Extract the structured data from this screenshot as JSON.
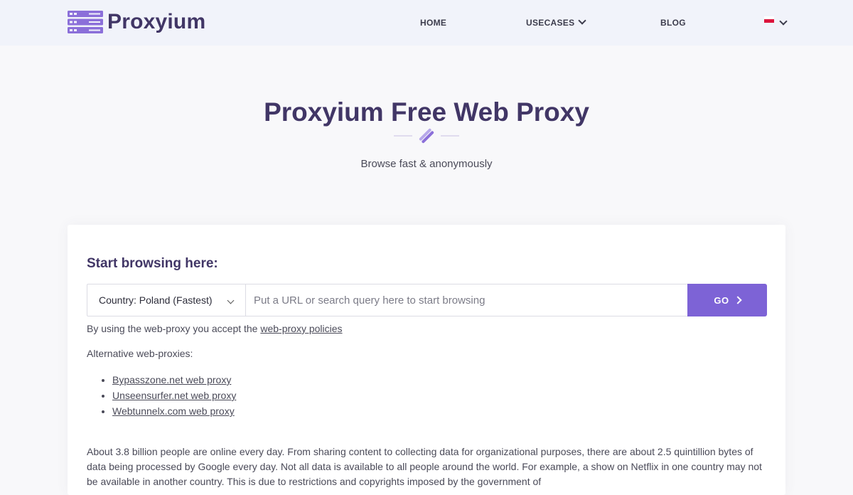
{
  "brand": {
    "name": "Proxyium"
  },
  "nav": {
    "home": "HOME",
    "usecases": "USECASES",
    "blog": "BLOG"
  },
  "hero": {
    "title": "Proxyium Free Web Proxy",
    "subtitle": "Browse fast & anonymously"
  },
  "form": {
    "heading": "Start browsing here:",
    "country_selected": "Country: Poland (Fastest)",
    "url_placeholder": "Put a URL or search query here to start browsing",
    "go_label": "GO",
    "terms_prefix": "By using the web-proxy you accept the ",
    "terms_link": "web-proxy policies"
  },
  "alternatives": {
    "label": "Alternative web-proxies:",
    "items": [
      "Bypasszone.net web proxy",
      "Unseensurfer.net web proxy",
      "Webtunnelx.com web proxy"
    ]
  },
  "about": {
    "text": "About 3.8 billion people are online every day. From sharing content to collecting data for organizational purposes, there are about 2.5 quintillion bytes of data being processed by Google every day. Not all data is available to all people around the world. For example, a show on Netflix in one country may not be available in another country. This is due to restrictions and copyrights imposed by the government of"
  },
  "colors": {
    "brand": "#413666",
    "accent": "#7d63d6",
    "header_bg": "#f1f3fa",
    "page_bg": "#f8f8fa"
  },
  "icons": {
    "logo": "server-stack-icon",
    "nav_dropdown": "chevron-down-icon",
    "language": "poland-flag-icon",
    "go": "chevron-right-icon"
  }
}
